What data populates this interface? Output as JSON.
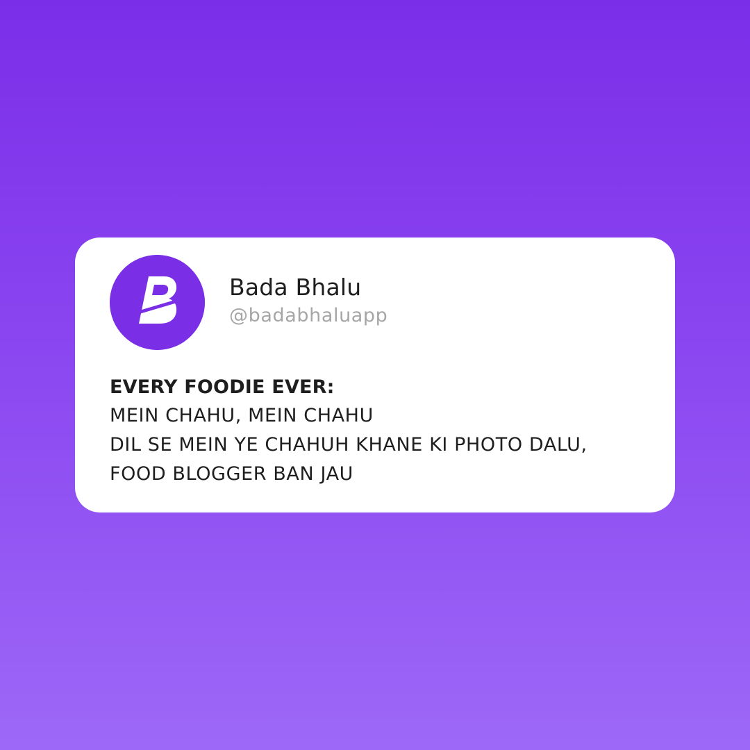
{
  "colors": {
    "background_top": "#7b2ee8",
    "background_bottom": "#9d68f7",
    "brand_purple": "#7a2ee6",
    "card": "#ffffff",
    "handle_gray": "#a6a6a6"
  },
  "profile": {
    "logo_icon": "b-letter-logo-icon",
    "display_name": "Bada Bhalu",
    "handle": "@badabhaluapp"
  },
  "post": {
    "heading": "EVERY FOODIE EVER:",
    "lines": [
      "MEIN CHAHU, MEIN CHAHU",
      "DIL SE MEIN YE CHAHUH KHANE KI PHOTO DALU,",
      "FOOD BLOGGER BAN JAU"
    ]
  }
}
